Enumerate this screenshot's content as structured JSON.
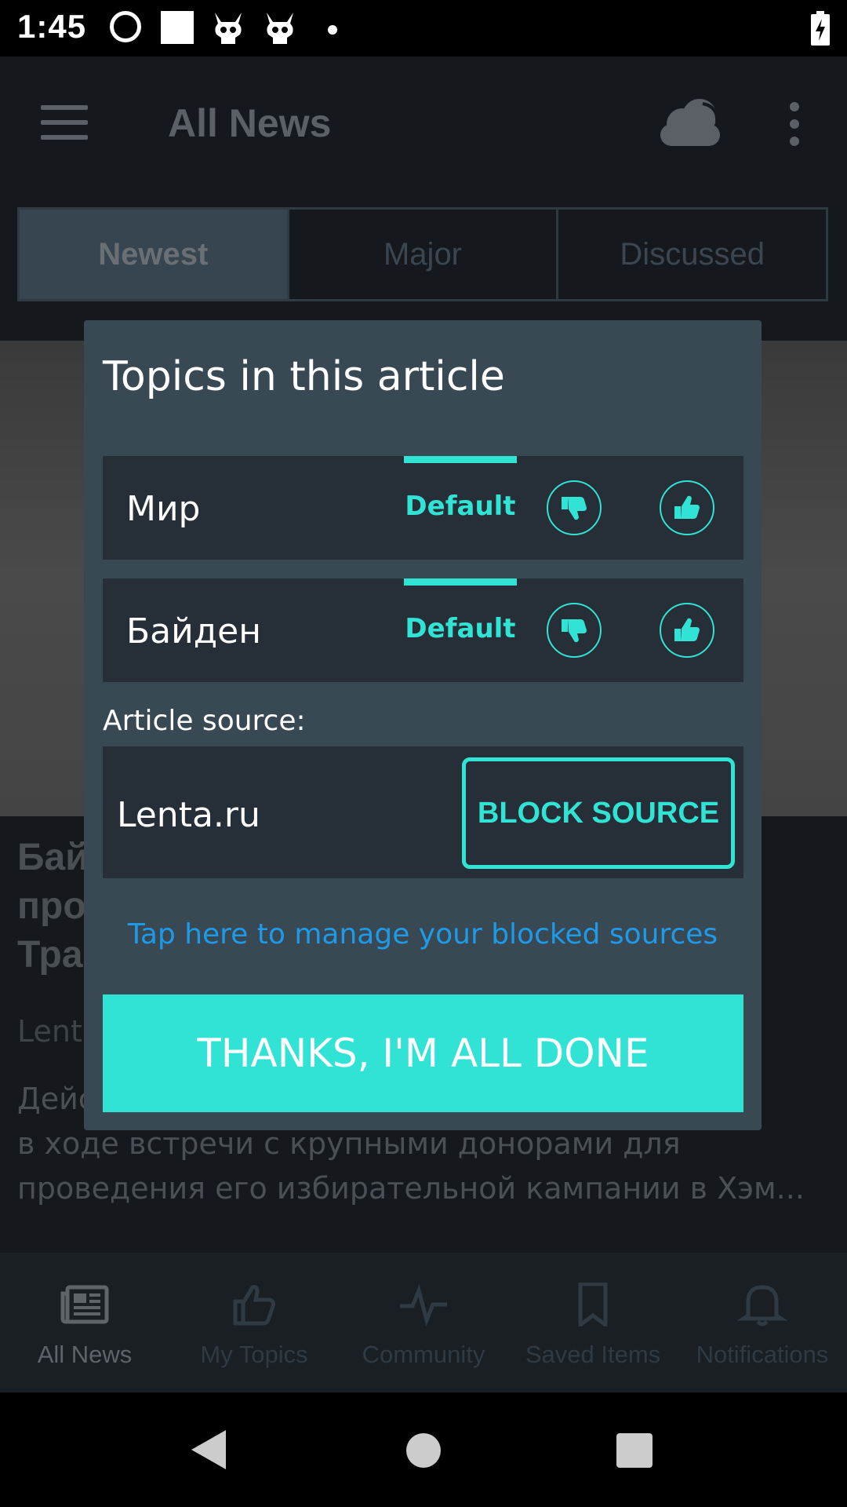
{
  "status_bar": {
    "time": "1:45",
    "icons": [
      "smiley-icon",
      "square-icon",
      "skull-icon",
      "skull-icon",
      "dot-icon",
      "battery-charging-icon"
    ]
  },
  "app": {
    "title": "All News",
    "icons": {
      "menu": "hamburger-icon",
      "weather": "cloud-icon",
      "more": "overflow-menu-icon"
    },
    "tabs": [
      {
        "label": "Newest",
        "active": true
      },
      {
        "label": "Major",
        "active": false
      },
      {
        "label": "Discussed",
        "active": false
      }
    ]
  },
  "article": {
    "title": "Бай\nпро\nТра",
    "source": "Lenta",
    "body": "Дейс\nв ходе встречи с крупными донорами для\nпроведения его избирательной кампании в Хэм..."
  },
  "bottom_nav": [
    {
      "label": "All News",
      "icon": "newspaper-icon",
      "active": true
    },
    {
      "label": "My Topics",
      "icon": "thumbs-up-icon",
      "active": false
    },
    {
      "label": "Community",
      "icon": "pulse-icon",
      "active": false
    },
    {
      "label": "Saved Items",
      "icon": "bookmark-icon",
      "active": false
    },
    {
      "label": "Notifications",
      "icon": "bell-icon",
      "active": false
    }
  ],
  "dialog": {
    "title": "Topics in this article",
    "topics": [
      {
        "name": "Мир",
        "status": "Default"
      },
      {
        "name": "Байден",
        "status": "Default"
      }
    ],
    "source_label": "Article source:",
    "source_name": "Lenta.ru",
    "block_button": "BLOCK SOURCE",
    "manage_link": "Tap here to manage your blocked sources",
    "done_button": "THANKS, I'M ALL DONE"
  },
  "colors": {
    "accent": "#31e3d4",
    "link": "#1e9ae8",
    "dialog_bg": "#394954",
    "row_bg": "#262f38"
  }
}
